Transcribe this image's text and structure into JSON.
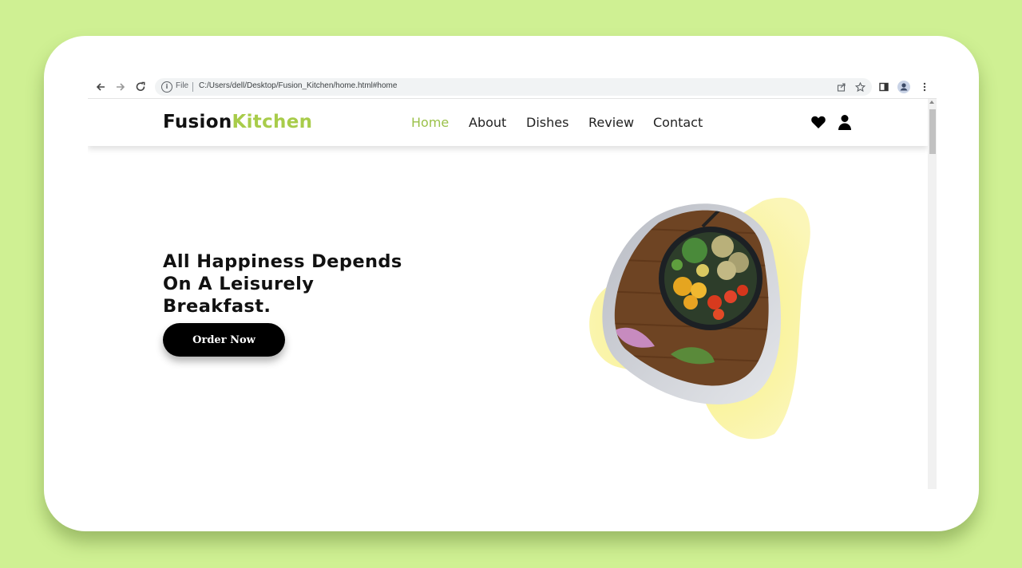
{
  "browser": {
    "scheme_label": "File",
    "url": "C:/Users/dell/Desktop/Fusion_Kitchen/home.html#home"
  },
  "site": {
    "logo_part1": "Fusion",
    "logo_part2": "Kitchen",
    "nav": [
      {
        "label": "Home",
        "active": true
      },
      {
        "label": "About"
      },
      {
        "label": "Dishes"
      },
      {
        "label": "Review"
      },
      {
        "label": "Contact"
      }
    ],
    "icons": [
      "heart-icon",
      "user-icon"
    ]
  },
  "hero": {
    "title_line1": "All Happiness Depends",
    "title_line2": "On A Leisurely",
    "title_line3": "Breakfast.",
    "cta_label": "Order Now"
  },
  "colors": {
    "page_background": "#cff093",
    "accent": "#a8cc4a",
    "blob": "#f8f08a"
  }
}
